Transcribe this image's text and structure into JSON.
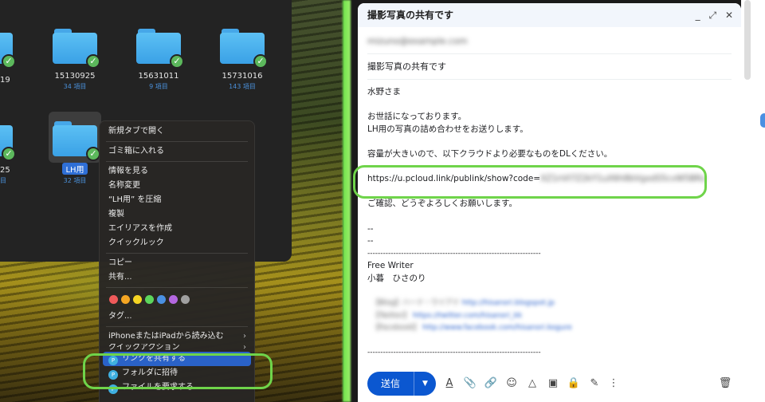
{
  "finder": {
    "folders": [
      {
        "name": "15130925",
        "count": "34 項目"
      },
      {
        "name": "15631011",
        "count": "9 項目"
      },
      {
        "name": "15731016",
        "count": "143 項目"
      },
      {
        "name": "LH用",
        "count": "32 項目"
      }
    ],
    "partial_left": [
      {
        "name": "19",
        "count": ""
      },
      {
        "name": "25",
        "count": "目"
      }
    ]
  },
  "context_menu": {
    "items_group1": [
      "新規タブで開く"
    ],
    "items_group2": [
      "ゴミ箱に入れる"
    ],
    "items_group3": [
      "情報を見る",
      "名称変更",
      "“LH用” を圧縮",
      "複製",
      "エイリアスを作成",
      "クイックルック"
    ],
    "items_group4": [
      "コピー",
      "共有..."
    ],
    "tag_colors": [
      "#f05a5a",
      "#f5a623",
      "#f5d423",
      "#5cd65c",
      "#4a90e2",
      "#b467e0",
      "#a0a0a0"
    ],
    "tags_label": "タグ...",
    "import_label": "iPhoneまたはiPadから読み込む",
    "quick_actions_label": "クイックアクション",
    "share_link_label": "リンクを共有する",
    "invite_folder_label": "フォルダに招待",
    "request_file_label": "ファイルを要求する",
    "pcloud_icon_letter": "P"
  },
  "compose": {
    "title": "撮影写真の共有です",
    "controls": {
      "minimize": "_",
      "expand": "⤢",
      "close": "✕"
    },
    "to_blurred": "mizuno@example.com",
    "subject": "撮影写真の共有です",
    "body": {
      "greeting": "水野さま",
      "line1": "お世話になっております。",
      "line2": "LH用の写真の詰め合わせをお送りします。",
      "line3": "容量が大きいので、以下クラウドより必要なものをDLください。",
      "link_prefix": "https://u.pcloud.link/publink/show?code=",
      "link_blurred": "XZ1nVI7Z2kY1uX6h8bVgxdS5cvW5BRz",
      "closing": "ご確認、どうぞよろしくお願いします。",
      "dash1": "--",
      "dash2": "--",
      "rule": "-------------------------------------------------------------------",
      "sig_role": "Free Writer",
      "sig_name": "小暮　ひさのり",
      "sig_blur1_label": "【Blog】ハード・ワイアド",
      "sig_blur1_link": "http://hisanori.blogspot.jp",
      "sig_blur2_label": "【Twitter】",
      "sig_blur2_link": "https://twitter.com/hisanori_kk",
      "sig_blur3_label": "【Facebook】",
      "sig_blur3_link": "http://www.facebook.com/hisanori.kogure",
      "rule2": "-------------------------------------------------------------------"
    },
    "send_label": "送信"
  }
}
